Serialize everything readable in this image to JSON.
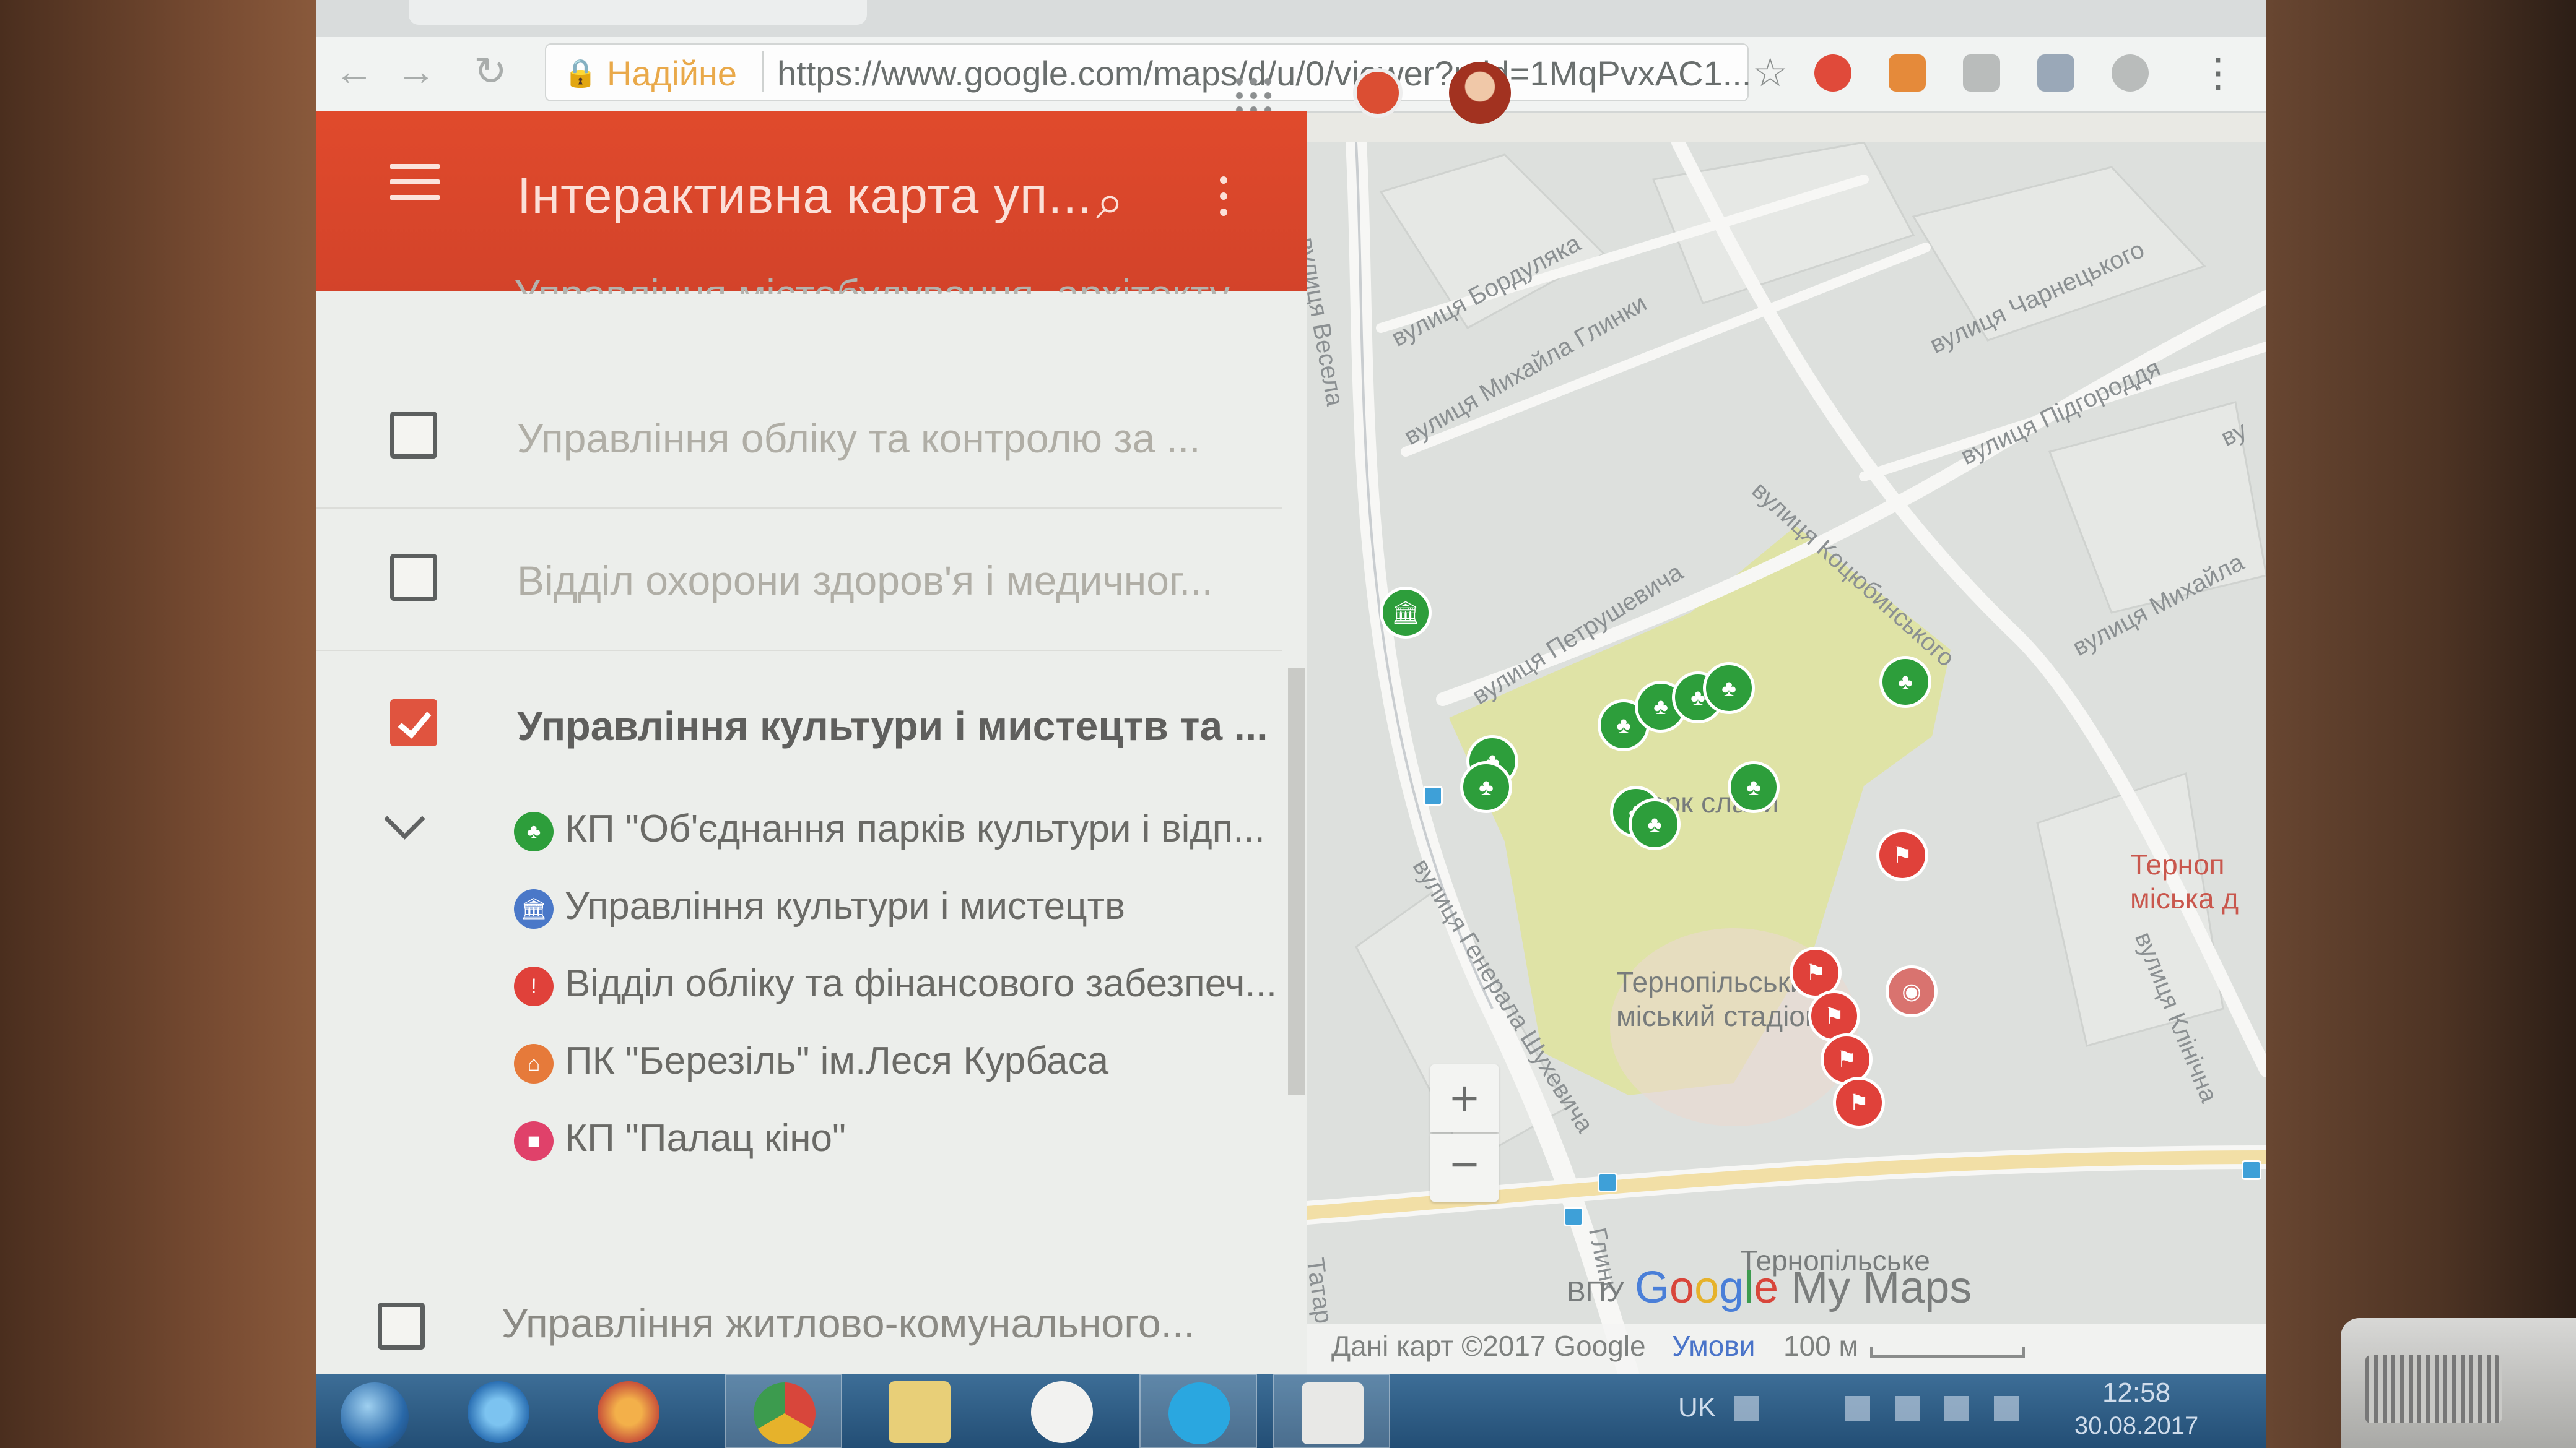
{
  "browser": {
    "secure_label": "Надійне",
    "url": "https://www.google.com/maps/d/u/0/viewer?mid=1MqPvxAC1..."
  },
  "header": {
    "title": "Інтерактивна карта уп...",
    "search_icon": "search-icon",
    "more_icon": "more-vert-icon"
  },
  "sidebar": {
    "cut_item": "Управління містобудування, архітекту...",
    "layers": [
      {
        "label": "Управління обліку та контролю за ...",
        "checked": false
      },
      {
        "label": "Відділ охорони здоров'я і медичног...",
        "checked": false
      },
      {
        "label": "Управління культури і мистецтв та ...",
        "checked": true
      },
      {
        "label": "Управління житлово-комунального...",
        "checked": false
      }
    ],
    "sub_items": [
      {
        "label": "КП \"Об'єднання парків культури і відп...",
        "color": "#2d9e3b"
      },
      {
        "label": "Управління культури і мистецтв",
        "color": "#4a78c8"
      },
      {
        "label": "Відділ обліку та фінансового забезпеч...",
        "color": "#e0413a"
      },
      {
        "label": "ПК \"Березіль\" ім.Леся Курбаса",
        "color": "#e67a3a"
      },
      {
        "label": "КП \"Палац кіно\"",
        "color": "#e0416a"
      }
    ]
  },
  "map": {
    "streets": {
      "vesela": "вулиця Весела",
      "bordulyaka": "вулиця Бордуляка",
      "mykhaila_hlynky": "вулиця Михайла Глинки",
      "charnetskoho": "вулиця Чарнецького",
      "pidhorodnya": "вулиця Підгороддя",
      "vu": "ву",
      "petrushevycha": "вулиця Петрушевича",
      "kotsiubynskoho": "вулиця Коцюбинського",
      "mykhaila": "вулиця Михайла",
      "shukhevycha": "вулиця Генерала Шухевича",
      "klinichna": "вулиця Клінічна",
      "hlynky": "Глинк",
      "tatarska": "Татар"
    },
    "pois": {
      "park": "Парк слави",
      "stadium_line1": "Тернопільський",
      "stadium_line2": "міський стадіон",
      "city_line1": "Терноп",
      "city_line2": "міська д",
      "vpu_line1": "Тернопільське",
      "vpu_prefix": "ВПУ"
    },
    "controls": {
      "zoom_in": "+",
      "zoom_out": "−"
    },
    "attribution": "Дані карт ©2017 Google",
    "terms": "Умови",
    "scale": "100 м",
    "brand_google": [
      "G",
      "o",
      "o",
      "g",
      "l",
      "e"
    ],
    "brand_suffix": " My Maps"
  },
  "taskbar": {
    "language": "UK",
    "time": "12:58",
    "date": "30.08.2017"
  },
  "colors": {
    "header_red": "#d3432a",
    "park_green": "#dfe3a6",
    "pin_green": "#2d9e3b",
    "pin_red": "#e0413a"
  }
}
